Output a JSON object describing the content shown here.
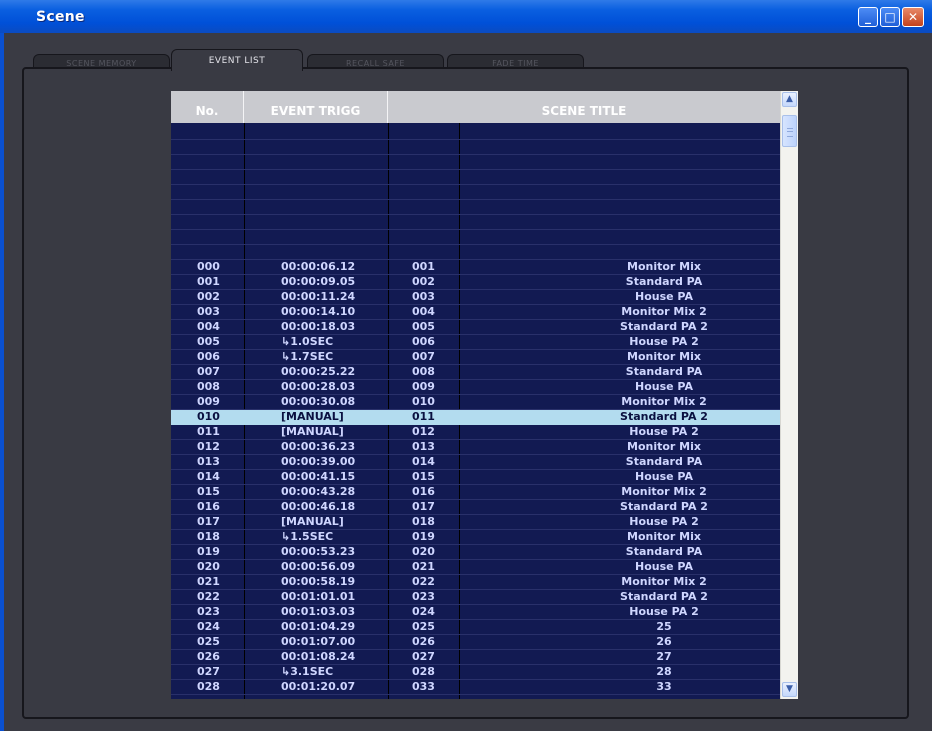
{
  "window": {
    "title": "Scene"
  },
  "tabs": [
    {
      "label": "SCENE MEMORY",
      "active": false
    },
    {
      "label": "EVENT LIST",
      "active": true
    },
    {
      "label": "RECALL SAFE",
      "active": false
    },
    {
      "label": "FADE TIME",
      "active": false
    }
  ],
  "table": {
    "headers": {
      "no": "No.",
      "event_trigger": "EVENT TRIGG",
      "scene": "",
      "scene_title": "SCENE TITLE"
    },
    "empty_rows": 9,
    "selected_index": 10,
    "rows": [
      {
        "no": "000",
        "trigger": "00:00:06.12",
        "scene": "001",
        "title": "Monitor Mix"
      },
      {
        "no": "001",
        "trigger": "00:00:09.05",
        "scene": "002",
        "title": "Standard PA"
      },
      {
        "no": "002",
        "trigger": "00:00:11.24",
        "scene": "003",
        "title": "House PA"
      },
      {
        "no": "003",
        "trigger": "00:00:14.10",
        "scene": "004",
        "title": "Monitor Mix 2"
      },
      {
        "no": "004",
        "trigger": "00:00:18.03",
        "scene": "005",
        "title": "Standard PA 2"
      },
      {
        "no": "005",
        "trigger": "↳1.0SEC",
        "scene": "006",
        "title": "House PA 2"
      },
      {
        "no": "006",
        "trigger": "↳1.7SEC",
        "scene": "007",
        "title": "Monitor Mix"
      },
      {
        "no": "007",
        "trigger": "00:00:25.22",
        "scene": "008",
        "title": "Standard PA"
      },
      {
        "no": "008",
        "trigger": "00:00:28.03",
        "scene": "009",
        "title": "House PA"
      },
      {
        "no": "009",
        "trigger": "00:00:30.08",
        "scene": "010",
        "title": "Monitor Mix 2"
      },
      {
        "no": "010",
        "trigger": "[MANUAL]",
        "scene": "011",
        "title": "Standard PA 2"
      },
      {
        "no": "011",
        "trigger": "[MANUAL]",
        "scene": "012",
        "title": "House PA 2"
      },
      {
        "no": "012",
        "trigger": "00:00:36.23",
        "scene": "013",
        "title": "Monitor Mix"
      },
      {
        "no": "013",
        "trigger": "00:00:39.00",
        "scene": "014",
        "title": "Standard PA"
      },
      {
        "no": "014",
        "trigger": "00:00:41.15",
        "scene": "015",
        "title": "House PA"
      },
      {
        "no": "015",
        "trigger": "00:00:43.28",
        "scene": "016",
        "title": "Monitor Mix 2"
      },
      {
        "no": "016",
        "trigger": "00:00:46.18",
        "scene": "017",
        "title": "Standard PA 2"
      },
      {
        "no": "017",
        "trigger": "[MANUAL]",
        "scene": "018",
        "title": "House PA 2"
      },
      {
        "no": "018",
        "trigger": "↳1.5SEC",
        "scene": "019",
        "title": "Monitor Mix"
      },
      {
        "no": "019",
        "trigger": "00:00:53.23",
        "scene": "020",
        "title": "Standard PA"
      },
      {
        "no": "020",
        "trigger": "00:00:56.09",
        "scene": "021",
        "title": "House PA"
      },
      {
        "no": "021",
        "trigger": "00:00:58.19",
        "scene": "022",
        "title": "Monitor Mix 2"
      },
      {
        "no": "022",
        "trigger": "00:01:01.01",
        "scene": "023",
        "title": "Standard PA 2"
      },
      {
        "no": "023",
        "trigger": "00:01:03.03",
        "scene": "024",
        "title": "House PA 2"
      },
      {
        "no": "024",
        "trigger": "00:01:04.29",
        "scene": "025",
        "title": "25"
      },
      {
        "no": "025",
        "trigger": "00:01:07.00",
        "scene": "026",
        "title": "26"
      },
      {
        "no": "026",
        "trigger": "00:01:08.24",
        "scene": "027",
        "title": "27"
      },
      {
        "no": "027",
        "trigger": "↳3.1SEC",
        "scene": "028",
        "title": "28"
      },
      {
        "no": "028",
        "trigger": "00:01:20.07",
        "scene": "033",
        "title": "33"
      }
    ]
  },
  "icons": {
    "minimize": "minimize-icon",
    "maximize": "maximize-icon",
    "close": "close-icon",
    "scroll_up": "arrow-up-icon",
    "scroll_down": "arrow-down-icon"
  }
}
